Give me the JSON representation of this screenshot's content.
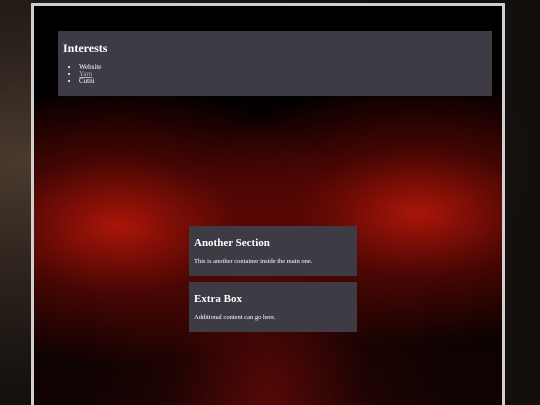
{
  "interests": {
    "title": "Interests",
    "items": [
      "Website",
      "Yarn",
      "Cutni"
    ]
  },
  "another_section": {
    "title": "Another Section",
    "text": "This is another container inside the main one."
  },
  "extra_box": {
    "title": "Extra Box",
    "text": "Additional content can go here."
  }
}
